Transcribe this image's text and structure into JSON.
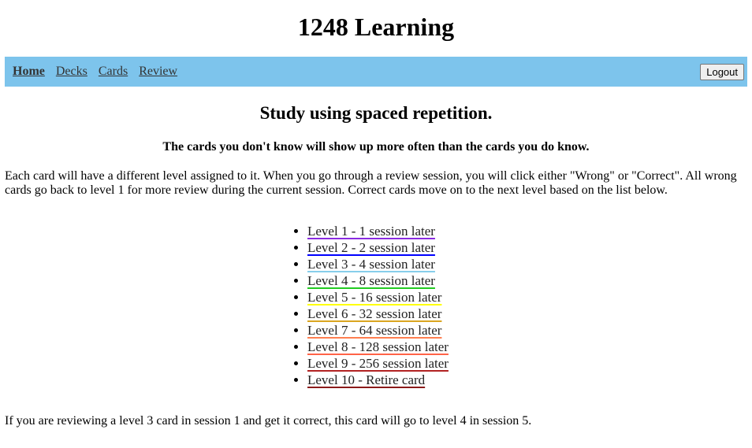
{
  "app_title": "1248 Learning",
  "nav": {
    "items": [
      {
        "label": "Home",
        "active": true
      },
      {
        "label": "Decks"
      },
      {
        "label": "Cards"
      },
      {
        "label": "Review"
      }
    ],
    "logout_label": "Logout"
  },
  "main": {
    "heading": "Study using spaced repetition.",
    "subheading": "The cards you don't know will show up more often than the cards you do know.",
    "intro": "Each card will have a different level assigned to it. When you go through a review session, you will click either \"Wrong\" or \"Correct\". All wrong cards go back to level 1 for more review during the current session. Correct cards move on to the next level based on the list below.",
    "levels": [
      {
        "label": "Level 1 - 1 session later",
        "color": "#8a2be2"
      },
      {
        "label": "Level 2 - 2 session later",
        "color": "#0000ff"
      },
      {
        "label": "Level 3 - 4 session later",
        "color": "#87ceeb"
      },
      {
        "label": "Level 4 - 8 session later",
        "color": "#22cc22"
      },
      {
        "label": "Level 5 - 16 session later",
        "color": "#ffff00"
      },
      {
        "label": "Level 6 - 32 session later",
        "color": "#daa520"
      },
      {
        "label": "Level 7 - 64 session later",
        "color": "#ff7f50"
      },
      {
        "label": "Level 8 - 128 session later",
        "color": "#ff6347"
      },
      {
        "label": "Level 9 - 256 session later",
        "color": "#b22222"
      },
      {
        "label": "Level 10 - Retire card",
        "color": "#8b1a1a"
      }
    ],
    "example": "If you are reviewing a level 3 card in session 1 and get it correct, this card will go to level 4 in session 5."
  }
}
